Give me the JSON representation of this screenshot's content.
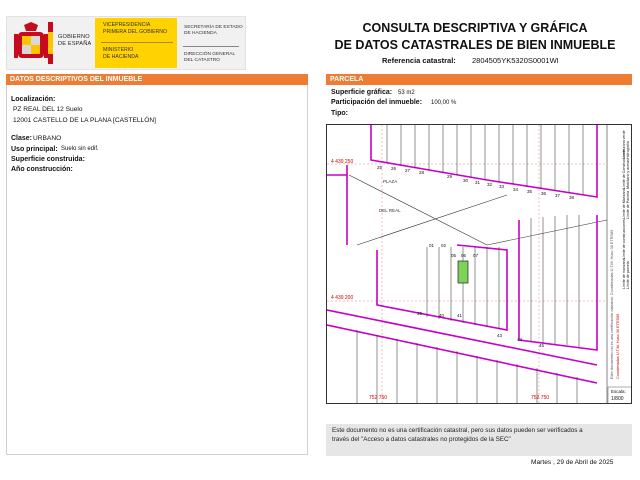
{
  "header": {
    "gobierno_line1": "GOBIERNO",
    "gobierno_line2": "DE ESPAÑA",
    "ministry_vice1": "VICEPRESIDENCIA",
    "ministry_vice2": "PRIMERA DEL GOBIERNO",
    "ministry_min1": "MINISTERIO",
    "ministry_min2": "DE HACIENDA",
    "org_sec1": "SECRETARÍA DE ESTADO",
    "org_sec2": "DE HACIENDA",
    "org_dir1": "DIRECCIÓN GENERAL",
    "org_dir2": "DEL CATASTRO",
    "title_line1": "CONSULTA DESCRIPTIVA Y GRÁFICA",
    "title_line2": "DE DATOS CATASTRALES DE BIEN INMUEBLE",
    "ref_label": "Referencia catastral:",
    "ref_value": "2804505YK5320S0001WI"
  },
  "left": {
    "band_title": "DATOS DESCRIPTIVOS DEL INMUEBLE",
    "localizacion_label": "Localización:",
    "localizacion_line1": "PZ REAL DEL 12 Suelo",
    "localizacion_line2": "12001 CASTELLO DE LA PLANA [CASTELLÓN]",
    "clase_label": "Clase:",
    "clase_value": "URBANO",
    "uso_label": "Uso principal:",
    "uso_value": "Suelo sin edif.",
    "superficie_label": "Superficie construida:",
    "anio_label": "Año construcción:"
  },
  "right": {
    "band_title": "PARCELA",
    "sup_grafica_label": "Superficie gráfica:",
    "sup_grafica_value": "53 m2",
    "participacion_label": "Participación del inmueble:",
    "participacion_value": "100,00 %",
    "tipo_label": "Tipo:"
  },
  "map": {
    "coord_y1": "4 439 250",
    "coord_y2": "4 439 200",
    "coord_x1": "752 750",
    "coord_x2": "752 750",
    "label_plaza": "PLAZA",
    "label_del_real": "DEL REAL",
    "parcel_numbers": [
      "25",
      "26",
      "27",
      "28",
      "29",
      "30",
      "31",
      "32",
      "33",
      "34",
      "35",
      "36",
      "37",
      "38",
      "01",
      "02",
      "03",
      "04",
      "05",
      "06",
      "07",
      "08",
      "09",
      "10",
      "11",
      "12",
      "13",
      "14",
      "15",
      "16",
      "17",
      "18",
      "19",
      "20",
      "21",
      "22",
      "23",
      "24",
      "37",
      "38",
      "39",
      "40",
      "41",
      "42",
      "43",
      "44",
      "45",
      "46",
      "47",
      "48"
    ],
    "escala_label": "Escala:",
    "escala_value": "1/800",
    "side_legend": [
      "Límite de Manzana",
      "Límite de Parcela",
      "Límite de Construcciones",
      "Mobiliario y aceras",
      "Límite zona verde",
      "Hidrografía"
    ],
    "side_legend_lower": [
      "Límite de manzana",
      "Límite de parcela",
      "Límite de construcciones"
    ],
    "side_note": "Coordenadas U.T.M. Huso 30 ETRS89",
    "accent_color": "#c800c8",
    "parcel_fill": "#7dd35a",
    "vertical_side_text": "Este documento no es una certificación catastral. Coordenadas U.T.M. Huso 30 ETRS89"
  },
  "footer": {
    "notice_line1": "Este documento no es una certificación catastral, pero sus datos pueden ser verificados a",
    "notice_line2": "través del \"Acceso a datos catastrales no protegidos de la SEC\"",
    "date": "Martes , 29 de Abril de 2025"
  }
}
